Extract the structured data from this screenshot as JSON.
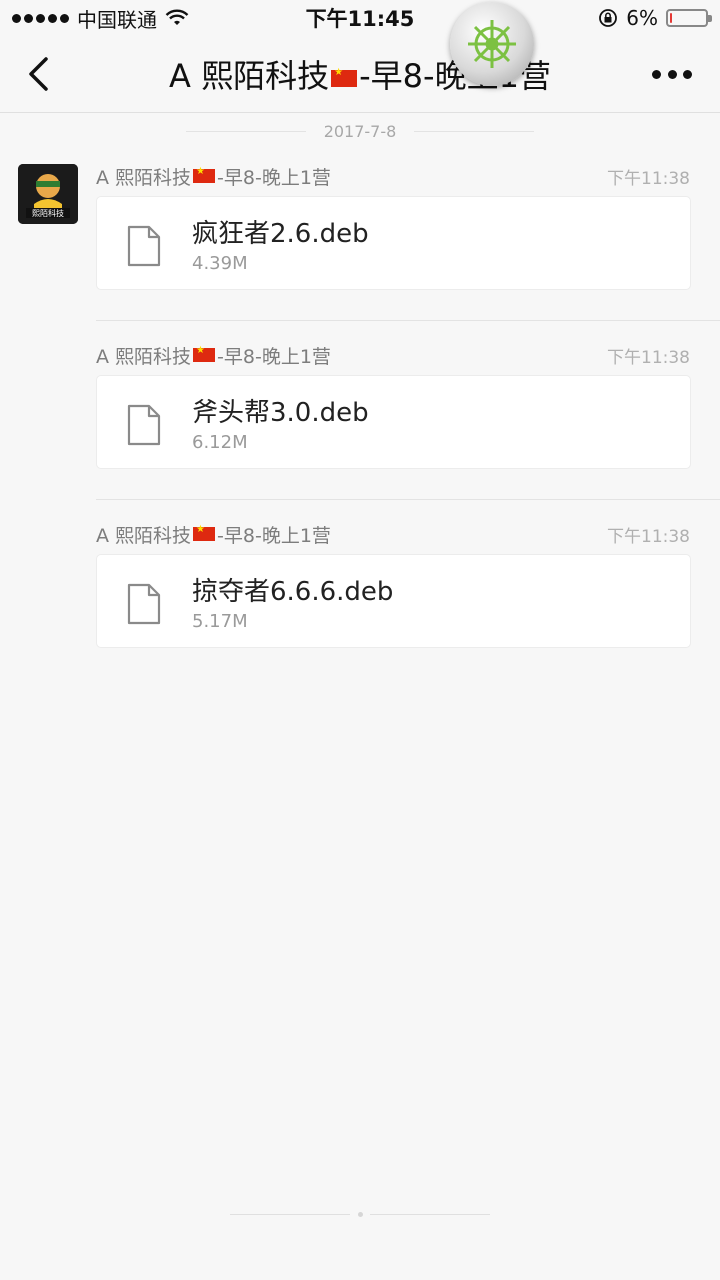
{
  "status_bar": {
    "carrier": "中国联通",
    "time": "下午11:45",
    "battery_percent": "6%",
    "battery_level": 0.06
  },
  "nav": {
    "title_prefix": "A  熙陌科技",
    "title_suffix": "-早8-晚上1营"
  },
  "date_separator": "2017-7-8",
  "messages": [
    {
      "sender_prefix": "A  熙陌科技",
      "sender_suffix": "-早8-晚上1营",
      "time": "下午11:38",
      "file_name": "疯狂者2.6.deb",
      "file_size": "4.39M",
      "avatar_text": "熙陌科技"
    },
    {
      "sender_prefix": "A  熙陌科技",
      "sender_suffix": "-早8-晚上1营",
      "time": "下午11:38",
      "file_name": "斧头帮3.0.deb",
      "file_size": "6.12M"
    },
    {
      "sender_prefix": "A  熙陌科技",
      "sender_suffix": "-早8-晚上1营",
      "time": "下午11:38",
      "file_name": "掠夺者6.6.6.deb",
      "file_size": "5.17M"
    }
  ],
  "colors": {
    "background": "#f7f7f7",
    "card": "#ffffff",
    "battery_low": "#e53935",
    "wheel_accent": "#7cc142"
  },
  "icons": {
    "back": "chevron-left-icon",
    "more": "more-dots-icon",
    "file": "document-icon",
    "wifi": "wifi-icon",
    "lock": "rotation-lock-icon",
    "wheel": "ship-wheel-icon"
  }
}
